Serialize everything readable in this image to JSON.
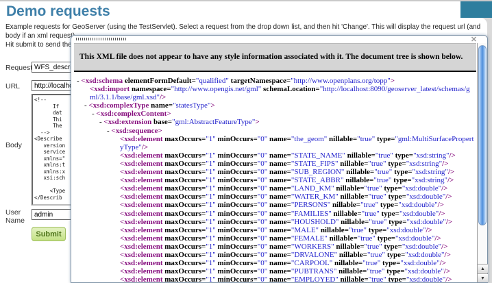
{
  "page": {
    "title": "Demo requests",
    "description_line1": "Example requests for GeoServer (using the TestServlet). Select a request from the drop down list, and then hit 'Change'. This will display the request url (and body if an xml request).",
    "description_line2": "Hit submit to send the requ"
  },
  "form": {
    "request_label": "Request",
    "request_value": "WFS_describeFe",
    "url_label": "URL",
    "url_value": "http://localho",
    "body_label": "Body",
    "body_value": "<!--\n      If \n      dat\n      Thi\n      The\n  -->\n<Describe\n   version\n   service\n   xmlns=\"\n   xmlns:t\n   xmlns:x\n   xsi:sch\n\n     <Type\n</Describ",
    "user_label_line1": "User",
    "user_label_line2": "Name",
    "user_value": "admin",
    "submit_label": "Submit"
  },
  "modal": {
    "close_icon": "✕",
    "message": "This XML file does not appear to have any style information associated with it. The document tree is shown below.",
    "scroll_up_icon": "▲",
    "scroll_down_icon": "▼"
  },
  "colors": {
    "heading_blue": "#3e7fa8",
    "header_teal": "#2e7e9e",
    "xml_tag": "#881280",
    "xml_attr_name": "#000000",
    "xml_attr_value": "#2222cc",
    "submit_green": "#50761c",
    "msgbar_gray": "#d5d5d5"
  },
  "xml_tree": {
    "rows": [
      {
        "indent": 0,
        "collapser": true,
        "tag": "xsd:schema",
        "attrs": [
          [
            "elementFormDefault",
            "qualified"
          ],
          [
            "targetNamespace",
            "http://www.openplans.org/topp"
          ]
        ],
        "selfClose": false
      },
      {
        "indent": 1,
        "collapser": false,
        "tag": "xsd:import",
        "attrs": [
          [
            "namespace",
            "http://www.opengis.net/gml"
          ],
          [
            "schemaLocation",
            "http://localhost:8090/geoserver_latest/schemas/gml/3.1.1/base/gml.xsd"
          ]
        ],
        "selfClose": true
      },
      {
        "indent": 1,
        "collapser": true,
        "tag": "xsd:complexType",
        "attrs": [
          [
            "name",
            "statesType"
          ]
        ],
        "selfClose": false
      },
      {
        "indent": 2,
        "collapser": true,
        "tag": "xsd:complexContent",
        "attrs": [],
        "selfClose": false
      },
      {
        "indent": 3,
        "collapser": true,
        "tag": "xsd:extension",
        "attrs": [
          [
            "base",
            "gml:AbstractFeatureType"
          ]
        ],
        "selfClose": false
      },
      {
        "indent": 4,
        "collapser": true,
        "tag": "xsd:sequence",
        "attrs": [],
        "selfClose": false
      },
      {
        "indent": 5,
        "collapser": false,
        "tag": "xsd:element",
        "attrs": [
          [
            "maxOccurs",
            "1"
          ],
          [
            "minOccurs",
            "0"
          ],
          [
            "name",
            "the_geom"
          ],
          [
            "nillable",
            "true"
          ],
          [
            "type",
            "gml:MultiSurfacePropertyType"
          ]
        ],
        "selfClose": true
      },
      {
        "indent": 5,
        "collapser": false,
        "tag": "xsd:element",
        "attrs": [
          [
            "maxOccurs",
            "1"
          ],
          [
            "minOccurs",
            "0"
          ],
          [
            "name",
            "STATE_NAME"
          ],
          [
            "nillable",
            "true"
          ],
          [
            "type",
            "xsd:string"
          ]
        ],
        "selfClose": true
      },
      {
        "indent": 5,
        "collapser": false,
        "tag": "xsd:element",
        "attrs": [
          [
            "maxOccurs",
            "1"
          ],
          [
            "minOccurs",
            "0"
          ],
          [
            "name",
            "STATE_FIPS"
          ],
          [
            "nillable",
            "true"
          ],
          [
            "type",
            "xsd:string"
          ]
        ],
        "selfClose": true
      },
      {
        "indent": 5,
        "collapser": false,
        "tag": "xsd:element",
        "attrs": [
          [
            "maxOccurs",
            "1"
          ],
          [
            "minOccurs",
            "0"
          ],
          [
            "name",
            "SUB_REGION"
          ],
          [
            "nillable",
            "true"
          ],
          [
            "type",
            "xsd:string"
          ]
        ],
        "selfClose": true
      },
      {
        "indent": 5,
        "collapser": false,
        "tag": "xsd:element",
        "attrs": [
          [
            "maxOccurs",
            "1"
          ],
          [
            "minOccurs",
            "0"
          ],
          [
            "name",
            "STATE_ABBR"
          ],
          [
            "nillable",
            "true"
          ],
          [
            "type",
            "xsd:string"
          ]
        ],
        "selfClose": true
      },
      {
        "indent": 5,
        "collapser": false,
        "tag": "xsd:element",
        "attrs": [
          [
            "maxOccurs",
            "1"
          ],
          [
            "minOccurs",
            "0"
          ],
          [
            "name",
            "LAND_KM"
          ],
          [
            "nillable",
            "true"
          ],
          [
            "type",
            "xsd:double"
          ]
        ],
        "selfClose": true
      },
      {
        "indent": 5,
        "collapser": false,
        "tag": "xsd:element",
        "attrs": [
          [
            "maxOccurs",
            "1"
          ],
          [
            "minOccurs",
            "0"
          ],
          [
            "name",
            "WATER_KM"
          ],
          [
            "nillable",
            "true"
          ],
          [
            "type",
            "xsd:double"
          ]
        ],
        "selfClose": true
      },
      {
        "indent": 5,
        "collapser": false,
        "tag": "xsd:element",
        "attrs": [
          [
            "maxOccurs",
            "1"
          ],
          [
            "minOccurs",
            "0"
          ],
          [
            "name",
            "PERSONS"
          ],
          [
            "nillable",
            "true"
          ],
          [
            "type",
            "xsd:double"
          ]
        ],
        "selfClose": true
      },
      {
        "indent": 5,
        "collapser": false,
        "tag": "xsd:element",
        "attrs": [
          [
            "maxOccurs",
            "1"
          ],
          [
            "minOccurs",
            "0"
          ],
          [
            "name",
            "FAMILIES"
          ],
          [
            "nillable",
            "true"
          ],
          [
            "type",
            "xsd:double"
          ]
        ],
        "selfClose": true
      },
      {
        "indent": 5,
        "collapser": false,
        "tag": "xsd:element",
        "attrs": [
          [
            "maxOccurs",
            "1"
          ],
          [
            "minOccurs",
            "0"
          ],
          [
            "name",
            "HOUSHOLD"
          ],
          [
            "nillable",
            "true"
          ],
          [
            "type",
            "xsd:double"
          ]
        ],
        "selfClose": true
      },
      {
        "indent": 5,
        "collapser": false,
        "tag": "xsd:element",
        "attrs": [
          [
            "maxOccurs",
            "1"
          ],
          [
            "minOccurs",
            "0"
          ],
          [
            "name",
            "MALE"
          ],
          [
            "nillable",
            "true"
          ],
          [
            "type",
            "xsd:double"
          ]
        ],
        "selfClose": true
      },
      {
        "indent": 5,
        "collapser": false,
        "tag": "xsd:element",
        "attrs": [
          [
            "maxOccurs",
            "1"
          ],
          [
            "minOccurs",
            "0"
          ],
          [
            "name",
            "FEMALE"
          ],
          [
            "nillable",
            "true"
          ],
          [
            "type",
            "xsd:double"
          ]
        ],
        "selfClose": true
      },
      {
        "indent": 5,
        "collapser": false,
        "tag": "xsd:element",
        "attrs": [
          [
            "maxOccurs",
            "1"
          ],
          [
            "minOccurs",
            "0"
          ],
          [
            "name",
            "WORKERS"
          ],
          [
            "nillable",
            "true"
          ],
          [
            "type",
            "xsd:double"
          ]
        ],
        "selfClose": true
      },
      {
        "indent": 5,
        "collapser": false,
        "tag": "xsd:element",
        "attrs": [
          [
            "maxOccurs",
            "1"
          ],
          [
            "minOccurs",
            "0"
          ],
          [
            "name",
            "DRVALONE"
          ],
          [
            "nillable",
            "true"
          ],
          [
            "type",
            "xsd:double"
          ]
        ],
        "selfClose": true
      },
      {
        "indent": 5,
        "collapser": false,
        "tag": "xsd:element",
        "attrs": [
          [
            "maxOccurs",
            "1"
          ],
          [
            "minOccurs",
            "0"
          ],
          [
            "name",
            "CARPOOL"
          ],
          [
            "nillable",
            "true"
          ],
          [
            "type",
            "xsd:double"
          ]
        ],
        "selfClose": true
      },
      {
        "indent": 5,
        "collapser": false,
        "tag": "xsd:element",
        "attrs": [
          [
            "maxOccurs",
            "1"
          ],
          [
            "minOccurs",
            "0"
          ],
          [
            "name",
            "PUBTRANS"
          ],
          [
            "nillable",
            "true"
          ],
          [
            "type",
            "xsd:double"
          ]
        ],
        "selfClose": true
      },
      {
        "indent": 5,
        "collapser": false,
        "tag": "xsd:element",
        "attrs": [
          [
            "maxOccurs",
            "1"
          ],
          [
            "minOccurs",
            "0"
          ],
          [
            "name",
            "EMPLOYED"
          ],
          [
            "nillable",
            "true"
          ],
          [
            "type",
            "xsd:double"
          ]
        ],
        "selfClose": true
      }
    ]
  }
}
